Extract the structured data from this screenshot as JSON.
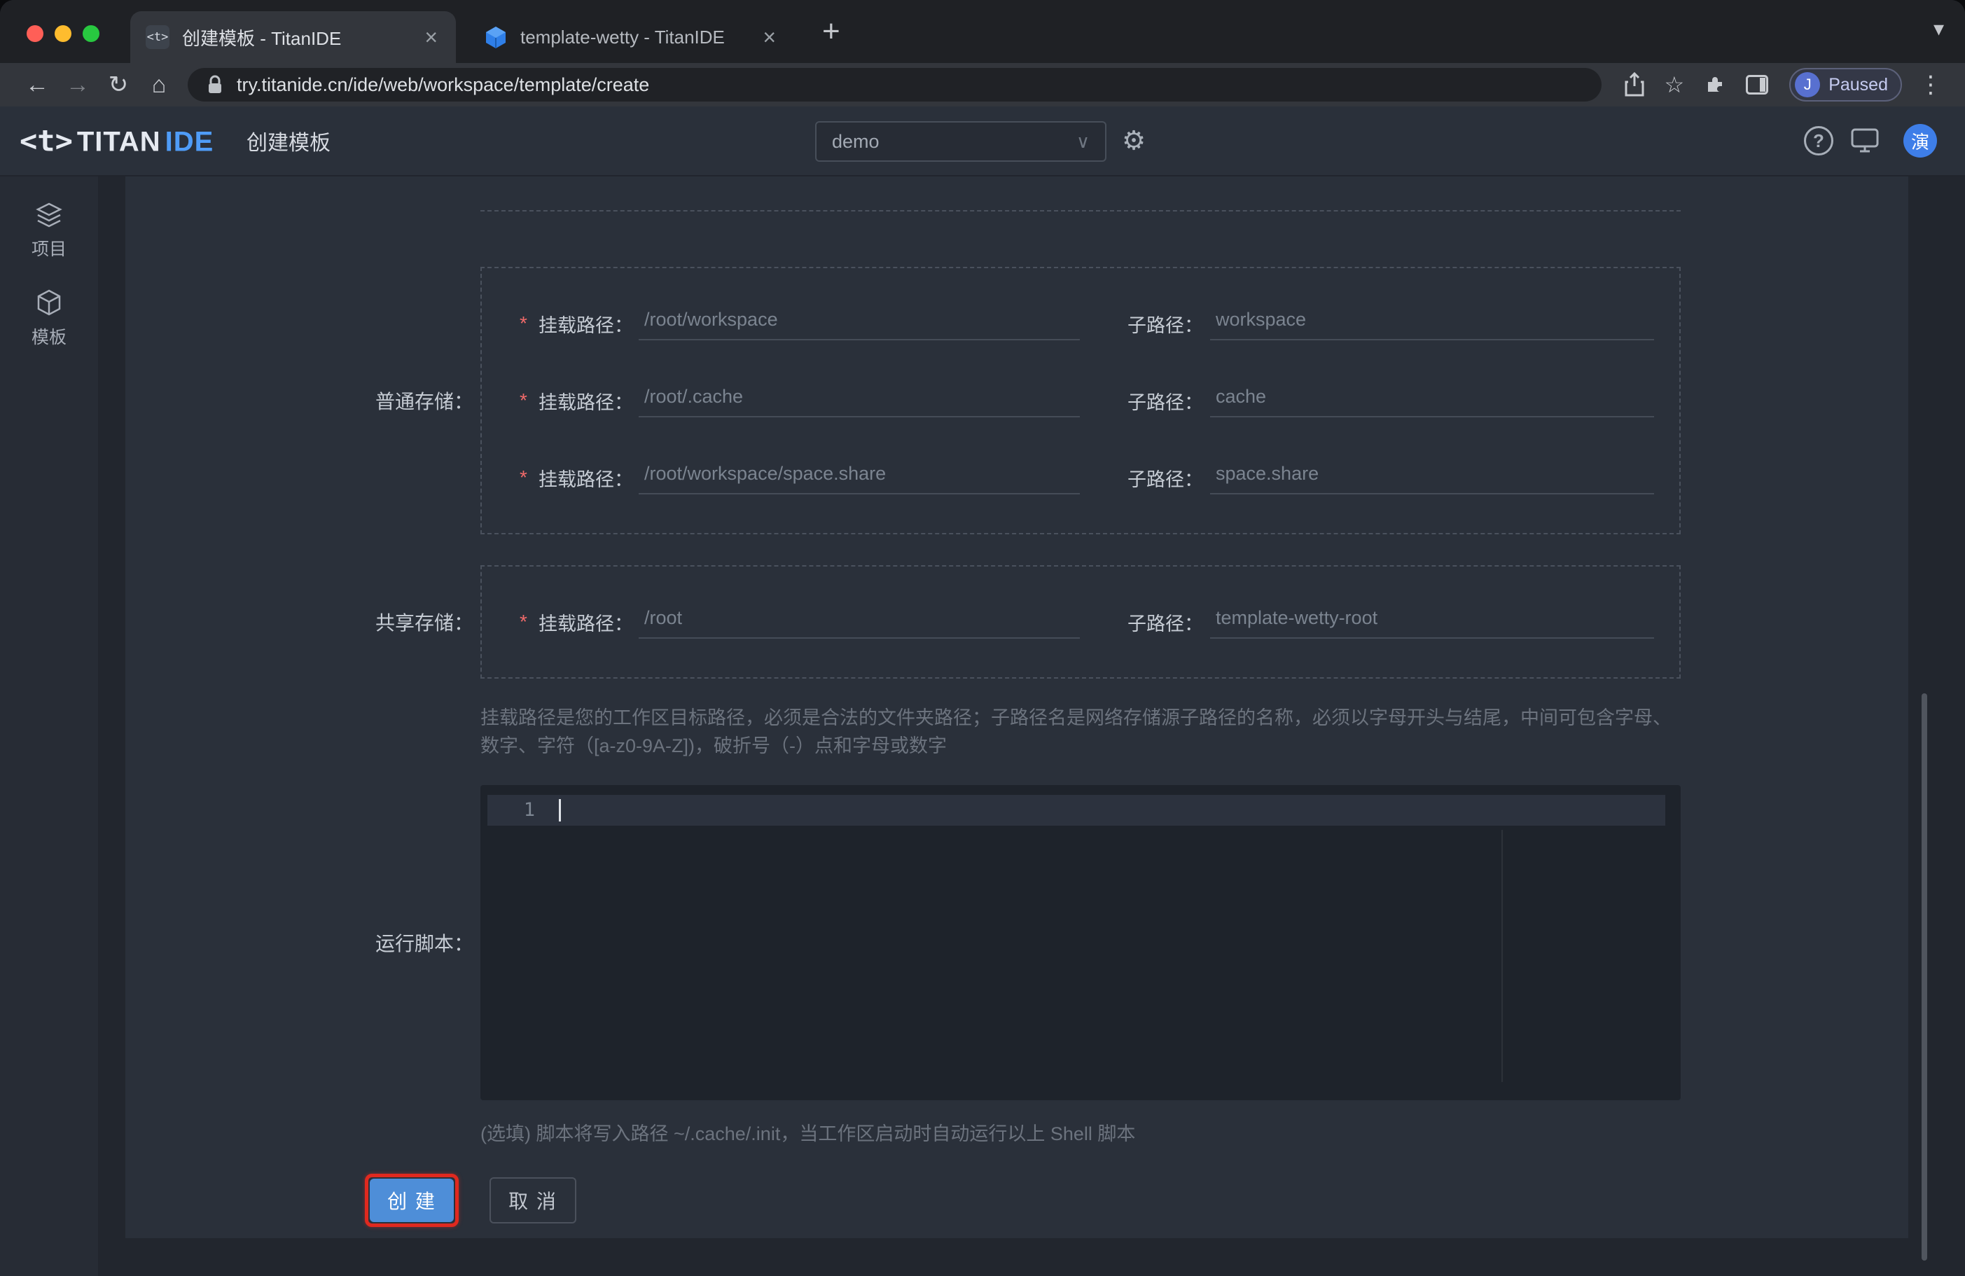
{
  "colors": {
    "accent_blue": "#4e8ed8",
    "highlight_ring_red": "#e0291f",
    "required_red": "#f06a6a",
    "logo_ide_blue": "#4f9cf7",
    "avatar_blue": "#3e7ee8"
  },
  "browser": {
    "tabs": [
      {
        "title": "创建模板 - TitanIDE",
        "active": true
      },
      {
        "title": "template-wetty - TitanIDE",
        "active": false
      }
    ],
    "url": "try.titanide.cn/ide/web/workspace/template/create",
    "profile": {
      "initial": "J",
      "status": "Paused"
    }
  },
  "icons": {
    "back": "←",
    "forward": "→",
    "reload": "↻",
    "home": "⌂",
    "new_tab": "+",
    "close_tab": "×",
    "tab_search": "▾",
    "star": "☆",
    "menu": "⋮",
    "gear": "⚙",
    "help": "?",
    "select_chevron": "∨",
    "favicon_mark": "<t>"
  },
  "app_header": {
    "logo_mark": "<t>",
    "logo_titan": "TITAN",
    "logo_ide": "IDE",
    "page_title": "创建模板",
    "workspace_select": "demo",
    "avatar": "演"
  },
  "sidebar": {
    "items": [
      {
        "label": "项目"
      },
      {
        "label": "模板"
      }
    ]
  },
  "form": {
    "required_mark": "*",
    "mount_label": "挂载路径：",
    "sub_label": "子路径：",
    "normal": {
      "label": "普通存储：",
      "rows": [
        {
          "mount_value": "/root/workspace",
          "sub_value": "workspace"
        },
        {
          "mount_value": "/root/.cache",
          "sub_value": "cache"
        },
        {
          "mount_value": "/root/workspace/space.share",
          "sub_value": "space.share"
        }
      ]
    },
    "shared": {
      "label": "共享存储：",
      "rows": [
        {
          "mount_value": "/root",
          "sub_value": "template-wetty-root"
        }
      ]
    },
    "path_hint": "挂载路径是您的工作区目标路径，必须是合法的文件夹路径；子路径名是网络存储源子路径的名称，必须以字母开头与结尾，中间可包含字母、数字、字符（[a-z0-9A-Z])，破折号（-）点和字母或数字",
    "script": {
      "label": "运行脚本：",
      "line_number": "1",
      "hint": "(选填) 脚本将写入路径 ~/.cache/.init，当工作区启动时自动运行以上 Shell 脚本"
    },
    "create_label": "创 建",
    "cancel_label": "取 消"
  }
}
